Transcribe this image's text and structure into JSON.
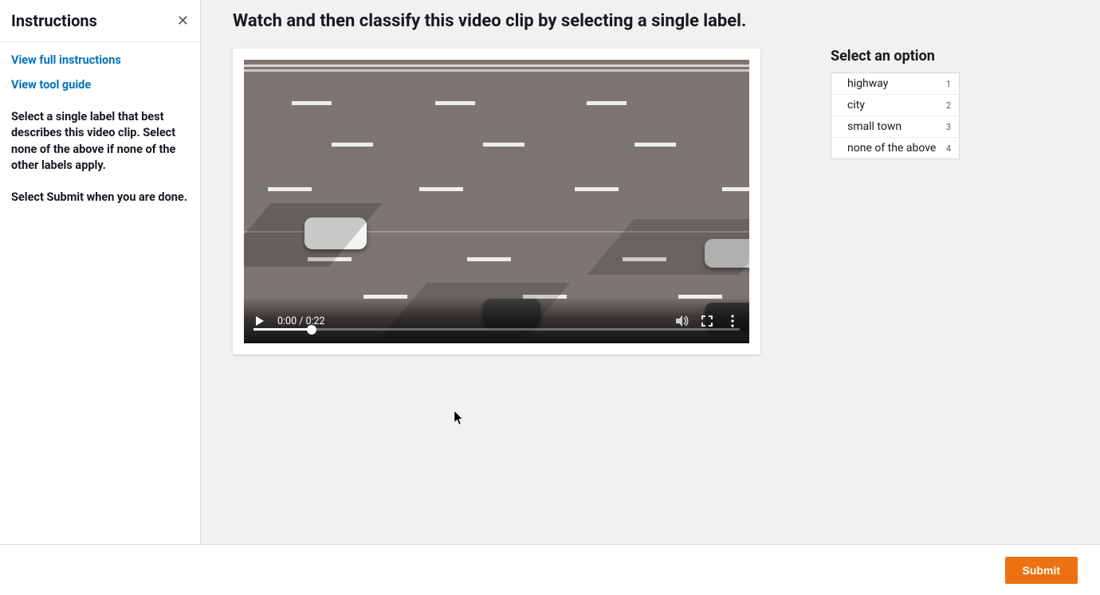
{
  "sidebar": {
    "title": "Instructions",
    "link_full_instructions": "View full instructions",
    "link_tool_guide": "View tool guide",
    "paragraph1": "Select a single label that best describes this video clip. Select none of the above if none of the other labels apply.",
    "paragraph2": "Select Submit when you are done."
  },
  "main": {
    "task_title": "Watch and then classify this video clip by selecting a single label."
  },
  "video": {
    "time_display": "0:00 / 0:22"
  },
  "options": {
    "title": "Select an option",
    "items": [
      {
        "label": "highway",
        "hotkey": "1"
      },
      {
        "label": "city",
        "hotkey": "2"
      },
      {
        "label": "small town",
        "hotkey": "3"
      },
      {
        "label": "none of the above",
        "hotkey": "4"
      }
    ]
  },
  "footer": {
    "submit_label": "Submit"
  }
}
